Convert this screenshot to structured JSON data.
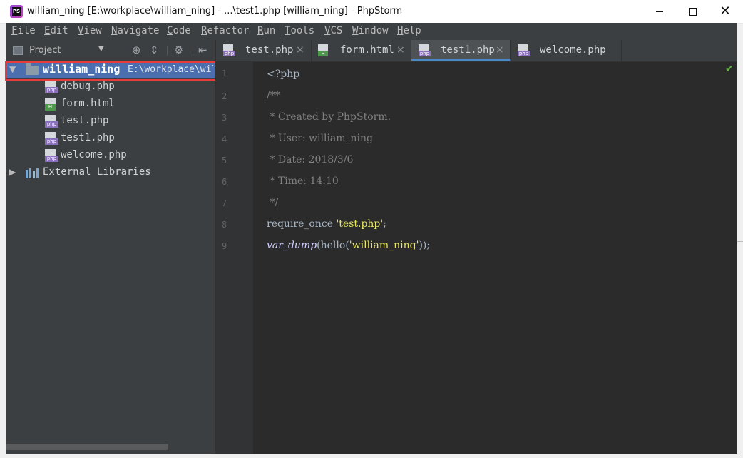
{
  "window": {
    "title": "william_ning [E:\\workplace\\william_ning] - ...\\test1.php [william_ning] - PhpStorm",
    "app_icon_text": "PS"
  },
  "menu": [
    "File",
    "Edit",
    "View",
    "Navigate",
    "Code",
    "Refactor",
    "Run",
    "Tools",
    "VCS",
    "Window",
    "Help"
  ],
  "project_panel": {
    "header_label": "Project",
    "root": {
      "name": "william_ning",
      "path": "E:\\workplace\\william_ning"
    },
    "files": [
      {
        "name": "debug.php",
        "type": "php"
      },
      {
        "name": "form.html",
        "type": "html"
      },
      {
        "name": "test.php",
        "type": "php"
      },
      {
        "name": "test1.php",
        "type": "php"
      },
      {
        "name": "welcome.php",
        "type": "php"
      }
    ],
    "external_libraries": "External Libraries"
  },
  "tabs": [
    {
      "label": "test.php",
      "type": "php",
      "active": false
    },
    {
      "label": "form.html",
      "type": "html",
      "active": false
    },
    {
      "label": "test1.php",
      "type": "php",
      "active": true
    },
    {
      "label": "welcome.php",
      "type": "php",
      "active": false
    }
  ],
  "icons": {
    "php_tag": "php",
    "html_tag": "H",
    "close": "×"
  },
  "editor": {
    "line_numbers": [
      "1",
      "2",
      "3",
      "4",
      "5",
      "6",
      "7",
      "8",
      "9"
    ],
    "lines": {
      "l1": "<?php",
      "l2": "/**",
      "l3": " * Created by PhpStorm.",
      "l4": " * User: william_ning",
      "l5": " * Date: 2018/3/6",
      "l6": " * Time: 14:10",
      "l7": " */",
      "l8_kw": "require_once ",
      "l8_str": "'test.php'",
      "l8_end": ";",
      "l9_func": "var_dump",
      "l9_mid": "(hello(",
      "l9_str": "'william_ning'",
      "l9_end": "));"
    }
  },
  "colors": {
    "editor_bg": "#2b2b2b",
    "panel_bg": "#3c3f41",
    "selection": "#4b6eaf",
    "highlight_box": "#e83b3b",
    "string": "#e8e861",
    "comment": "#808080"
  }
}
